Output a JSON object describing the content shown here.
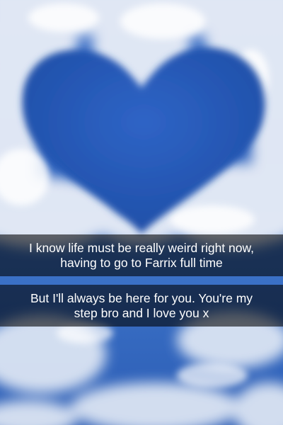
{
  "snap": {
    "background_description": "",
    "captions": [
      {
        "lines": [
          "I know life must be really weird right now,",
          "having to go to Farrix full time"
        ]
      },
      {
        "lines": [
          "But I'll always be here for you. You're my",
          "step bro and I love you x"
        ]
      }
    ]
  }
}
